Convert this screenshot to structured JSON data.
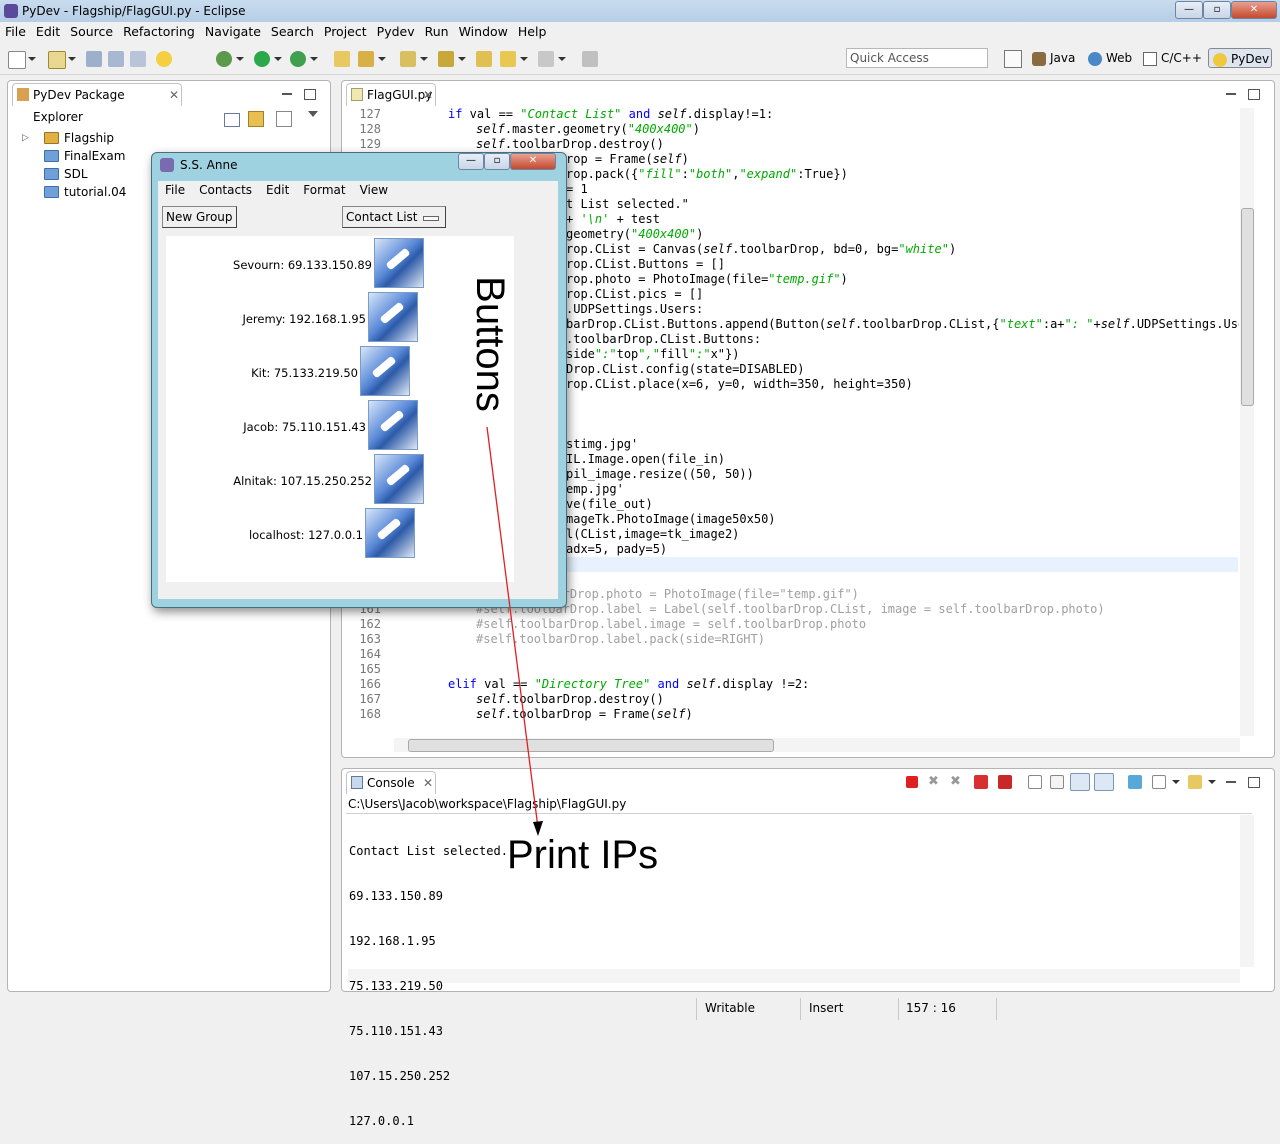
{
  "window": {
    "title": "PyDev - Flagship/FlagGUI.py - Eclipse",
    "controls": {
      "minimize": "—",
      "maximize": "▫",
      "close": "✕"
    }
  },
  "menubar": {
    "items": [
      "File",
      "Edit",
      "Source",
      "Refactoring",
      "Navigate",
      "Search",
      "Project",
      "Pydev",
      "Run",
      "Window",
      "Help"
    ]
  },
  "toolbar": {
    "quick_access_placeholder": "Quick Access",
    "perspectives": [
      "Java",
      "Web",
      "C/C++",
      "PyDev"
    ]
  },
  "explorer": {
    "tab_label": "PyDev Package Explorer",
    "items": [
      "Flagship",
      "FinalExam",
      "SDL",
      "tutorial.04"
    ]
  },
  "editor": {
    "tab_label": "FlagGUI.py",
    "lines": [
      {
        "n": "127",
        "t": "if val == \"Contact List\" and self.display!=1:"
      },
      {
        "n": "128",
        "t": "self.master.geometry(\"400x400\")"
      },
      {
        "n": "129",
        "t": "self.toolbarDrop.destroy()"
      },
      {
        "n": "",
        "t": "rop = Frame(self)"
      },
      {
        "n": "",
        "t": "rop.pack({\"fill\":\"both\",\"expand\":True})"
      },
      {
        "n": "",
        "t": "= 1"
      },
      {
        "n": "",
        "t": "t List selected.\""
      },
      {
        "n": "",
        "t": "+ '\\n' + test"
      },
      {
        "n": "",
        "t": "geometry(\"400x400\")"
      },
      {
        "n": "",
        "t": "rop.CList = Canvas(self.toolbarDrop, bd=0, bg=\"white\")"
      },
      {
        "n": "",
        "t": "rop.CList.Buttons = []"
      },
      {
        "n": "",
        "t": "rop.photo = PhotoImage(file=\"temp.gif\")"
      },
      {
        "n": "",
        "t": "rop.CList.pics = []"
      },
      {
        "n": "",
        "t": ".UDPSettings.Users:"
      },
      {
        "n": "",
        "t": "barDrop.CList.Buttons.append(Button(self.toolbarDrop.CList,{\"text\":a+\": \"+self.UDPSettings.Users"
      },
      {
        "n": "",
        "t": ".toolbarDrop.CList.Buttons:"
      },
      {
        "n": "",
        "t": "side\":\"top\",\"fill\":\"x\"})"
      },
      {
        "n": "",
        "t": "Drop.CList.config(state=DISABLED)"
      },
      {
        "n": "",
        "t": "rop.CList.place(x=6, y=0, width=350, height=350)"
      },
      {
        "n": "",
        "t": ""
      },
      {
        "n": "",
        "t": ""
      },
      {
        "n": "",
        "t": ""
      },
      {
        "n": "",
        "t": "stimg.jpg'"
      },
      {
        "n": "",
        "t": "IL.Image.open(file_in)"
      },
      {
        "n": "",
        "t": "pil_image.resize((50, 50))"
      },
      {
        "n": "",
        "t": "emp.jpg'"
      },
      {
        "n": "",
        "t": "ve(file_out)"
      },
      {
        "n": "",
        "t": "mageTk.PhotoImage(image50x50)"
      },
      {
        "n": "",
        "t": "l(CList,image=tk_image2)"
      },
      {
        "n": "",
        "t": "adx=5, pady=5)"
      },
      {
        "n": "",
        "t": ""
      },
      {
        "n": "",
        "t": ""
      },
      {
        "n": "160",
        "t": "#self.toolbarDrop.photo = PhotoImage(file=\"temp.gif\")"
      },
      {
        "n": "161",
        "t": "#self.toolbarDrop.label = Label(self.toolbarDrop.CList, image = self.toolbarDrop.photo)"
      },
      {
        "n": "162",
        "t": "#self.toolbarDrop.label.image = self.toolbarDrop.photo"
      },
      {
        "n": "163",
        "t": "#self.toolbarDrop.label.pack(side=RIGHT)"
      },
      {
        "n": "164",
        "t": ""
      },
      {
        "n": "165",
        "t": ""
      },
      {
        "n": "166",
        "t": "elif val == \"Directory Tree\" and self.display !=2:"
      },
      {
        "n": "167",
        "t": "self.toolbarDrop.destroy()"
      },
      {
        "n": "168",
        "t": "self.toolbarDrop = Frame(self)"
      }
    ]
  },
  "dialog": {
    "title": "S.S. Anne",
    "menu": [
      "File",
      "Contacts",
      "Edit",
      "Format",
      "View"
    ],
    "new_group_button": "New Group",
    "contact_list_button": "Contact List",
    "contacts": [
      "Sevourn: 69.133.150.89",
      "Jeremy: 192.168.1.95",
      "Kit: 75.133.219.50",
      "Jacob: 75.110.151.43",
      "Alnitak: 107.15.250.252",
      "localhost: 127.0.0.1"
    ]
  },
  "annotations": {
    "buttons": "Buttons",
    "print_ips": "Print IPs",
    "arrow_color": "#e02020"
  },
  "console": {
    "tab_label": "Console",
    "path": "C:\\Users\\Jacob\\workspace\\Flagship\\FlagGUI.py",
    "output": [
      "Contact List selected.",
      "69.133.150.89",
      "192.168.1.95",
      "75.133.219.50",
      "75.110.151.43",
      "107.15.250.252",
      "127.0.0.1"
    ]
  },
  "statusbar": {
    "mode": "Writable",
    "insert": "Insert",
    "position": "157 : 16"
  }
}
